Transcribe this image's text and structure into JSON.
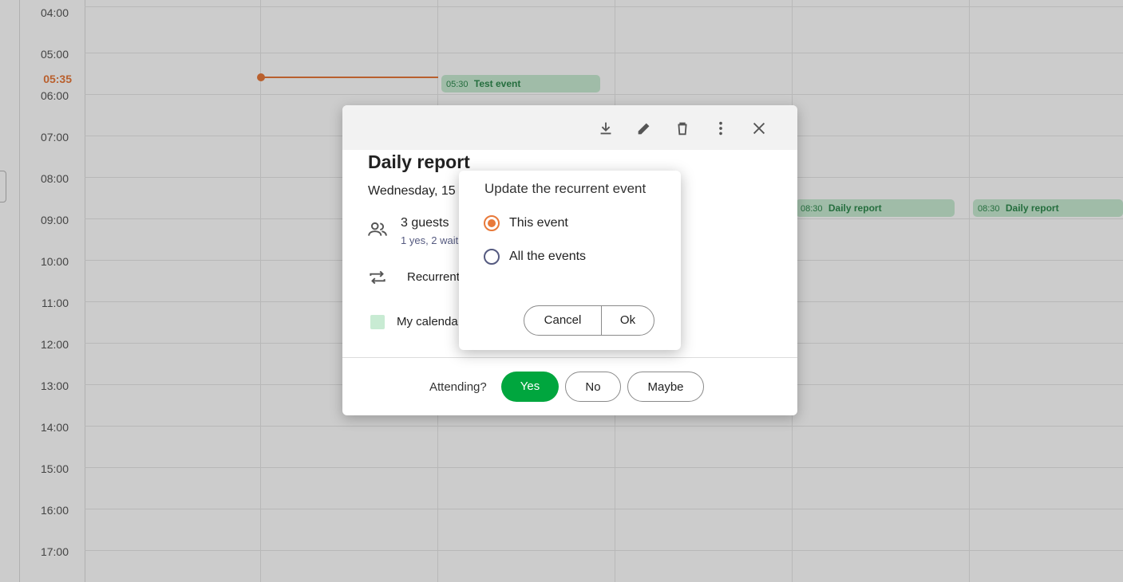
{
  "calendar": {
    "hours": [
      "04:00",
      "05:00",
      "06:00",
      "07:00",
      "08:00",
      "09:00",
      "10:00",
      "11:00",
      "12:00",
      "13:00",
      "14:00",
      "15:00",
      "16:00",
      "17:00"
    ],
    "now_label": "05:35",
    "events": [
      {
        "time": "05:30",
        "title": "Test event"
      },
      {
        "time": "08:30",
        "title": "Daily report"
      },
      {
        "time": "08:30",
        "title": "Daily report"
      }
    ],
    "accent_color": "#e8793a",
    "event_color": "#c8ebd3"
  },
  "details": {
    "toolbar": {
      "download": "download-icon",
      "edit": "pencil-icon",
      "delete": "trash-icon",
      "more": "more-vertical-icon",
      "close": "close-icon"
    },
    "title": "Daily report",
    "date": "Wednesday, 15",
    "guests_count": "3 guests",
    "guests_summary": "1 yes, 2 wait",
    "recurrence": "Recurrent",
    "calendar_name": "My calenda",
    "attending_label": "Attending?",
    "yes_label": "Yes",
    "no_label": "No",
    "maybe_label": "Maybe",
    "yes_color": "#00a63e"
  },
  "recurrent_dialog": {
    "title": "Update the recurrent event",
    "options": [
      {
        "label": "This event",
        "checked": true
      },
      {
        "label": "All the events",
        "checked": false
      }
    ],
    "cancel_label": "Cancel",
    "ok_label": "Ok"
  }
}
